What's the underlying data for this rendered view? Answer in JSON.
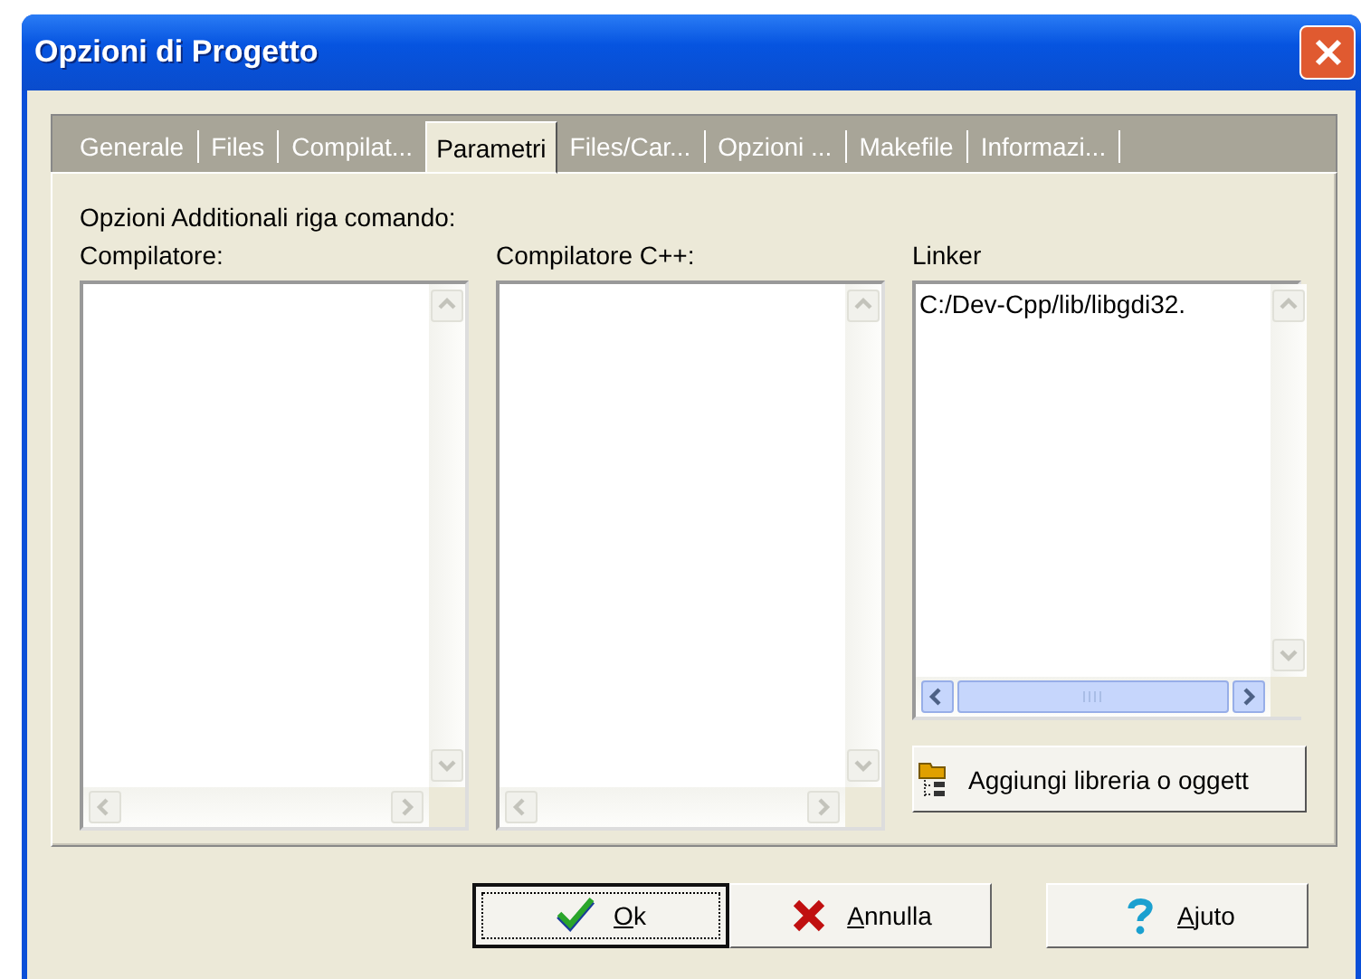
{
  "window": {
    "title": "Opzioni di Progetto"
  },
  "tabs": [
    {
      "label": "Generale",
      "selected": false
    },
    {
      "label": "Files",
      "selected": false
    },
    {
      "label": "Compilat...",
      "selected": false
    },
    {
      "label": "Parametri",
      "selected": true
    },
    {
      "label": "Files/Car...",
      "selected": false
    },
    {
      "label": "Opzioni ...",
      "selected": false
    },
    {
      "label": "Makefile",
      "selected": false
    },
    {
      "label": "Informazi...",
      "selected": false
    }
  ],
  "heading": "Opzioni Additionali riga comando:",
  "columns": [
    {
      "label": "Compilatore:"
    },
    {
      "label": "Compilatore C++:"
    },
    {
      "label": "Linker",
      "lines": [
        "C:/Dev-Cpp/lib/libgdi32."
      ],
      "action": "Aggiungi libreria o oggett"
    }
  ],
  "buttons": [
    {
      "kind": "ok",
      "label": "Ok",
      "default": true,
      "accel_underlined": true
    },
    {
      "kind": "cancel",
      "label": "Annulla",
      "default": false,
      "accel_underlined": true
    },
    {
      "kind": "help",
      "label": "Ajuto",
      "default": false,
      "accel_underlined": true
    }
  ]
}
